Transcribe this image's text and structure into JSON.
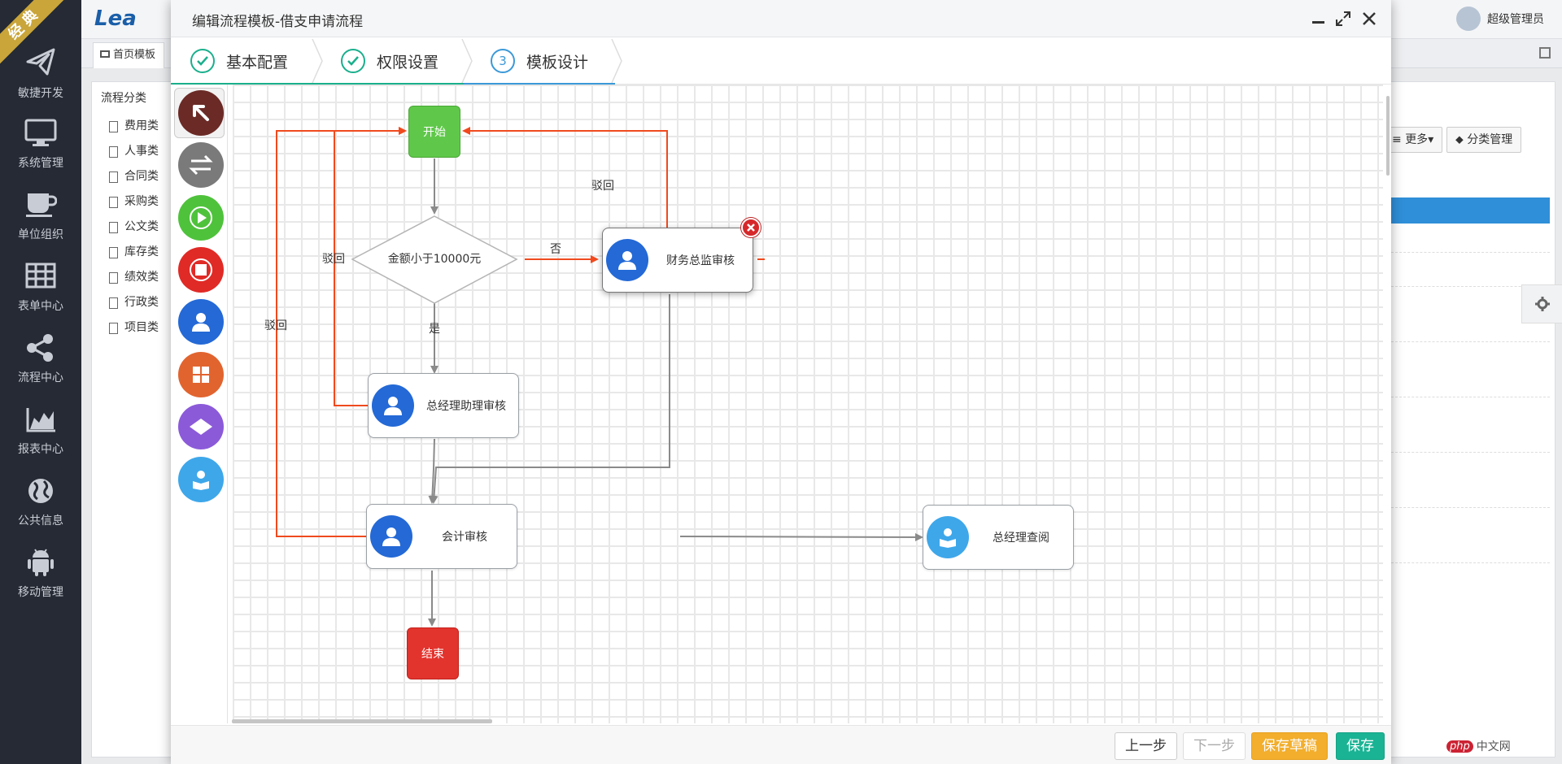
{
  "sidebar": {
    "ribbon": "经典",
    "items": [
      {
        "label": "敏捷开发",
        "icon": "paper-plane-icon"
      },
      {
        "label": "系统管理",
        "icon": "monitor-icon"
      },
      {
        "label": "单位组织",
        "icon": "coffee-cup-icon"
      },
      {
        "label": "表单中心",
        "icon": "grid-table-icon"
      },
      {
        "label": "流程中心",
        "icon": "share-nodes-icon"
      },
      {
        "label": "报表中心",
        "icon": "area-chart-icon"
      },
      {
        "label": "公共信息",
        "icon": "globe-icon"
      },
      {
        "label": "移动管理",
        "icon": "android-icon"
      }
    ]
  },
  "background": {
    "logo": "Lea",
    "tab_label": "首页模板",
    "category_title": "流程分类",
    "categories": [
      "费用类",
      "人事类",
      "合同类",
      "采购类",
      "公文类",
      "库存类",
      "绩效类",
      "行政类",
      "项目类"
    ],
    "user_name": "超级管理员",
    "more_button": "更多",
    "category_manage_button": "分类管理",
    "watermark": "中文网",
    "watermark_logo": "php"
  },
  "modal": {
    "title": "编辑流程模板-借支申请流程",
    "steps": [
      {
        "label": "基本配置",
        "state": "done"
      },
      {
        "label": "权限设置",
        "state": "done"
      },
      {
        "label": "模板设计",
        "state": "active",
        "number": "3"
      }
    ],
    "palette": [
      {
        "name": "pointer-tool",
        "color": "#6b2a26"
      },
      {
        "name": "connector-tool",
        "color": "#7a7a7a"
      },
      {
        "name": "start-node-tool",
        "color": "#4fc23c"
      },
      {
        "name": "end-node-tool",
        "color": "#e02a26"
      },
      {
        "name": "task-node-tool",
        "color": "#2469d6"
      },
      {
        "name": "parallel-node-tool",
        "color": "#e1642f"
      },
      {
        "name": "condition-node-tool",
        "color": "#8b5ad9"
      },
      {
        "name": "review-node-tool",
        "color": "#3ea7ea"
      }
    ],
    "flow": {
      "start": "开始",
      "end": "结束",
      "condition": "金额小于10000元",
      "tasks": {
        "finance": "财务总监审核",
        "assistant": "总经理助理审核",
        "accounting": "会计审核",
        "gm_review": "总经理查阅"
      },
      "edge_labels": {
        "no": "否",
        "yes": "是",
        "reject_finance": "驳回",
        "reject_assistant": "驳回",
        "reject_accounting": "驳回"
      }
    },
    "footer": {
      "prev": "上一步",
      "next": "下一步",
      "save_draft": "保存草稿",
      "save": "保存"
    }
  },
  "colors": {
    "sidebar_bg": "#252a34",
    "accent_green": "#1aaf8c",
    "accent_blue": "#3b99d8",
    "reject_line": "#f04a1e",
    "normal_line": "#8a8a8a"
  }
}
